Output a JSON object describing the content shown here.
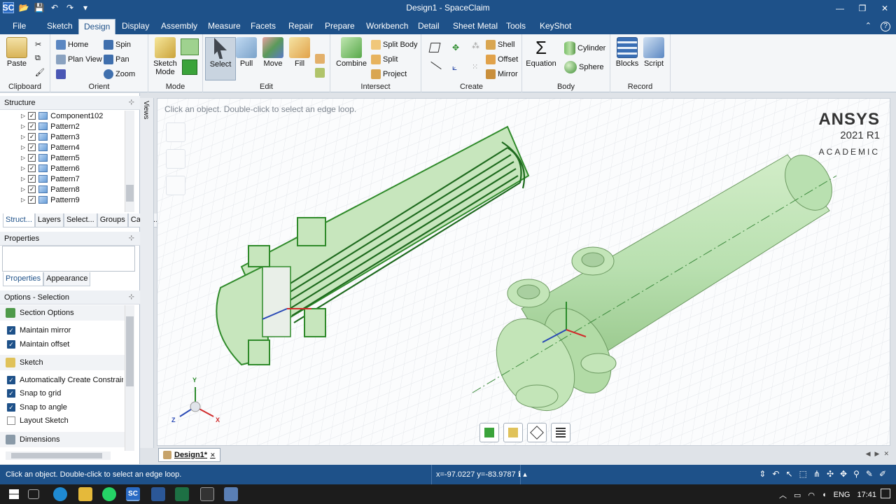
{
  "window": {
    "title": "Design1 - SpaceClaim",
    "app_badge": "SC",
    "minimize": "—",
    "maximize": "❐",
    "close": "✕"
  },
  "qat": {
    "open": "📂",
    "save": "💾",
    "undo": "↶",
    "redo": "↷",
    "more": "▾"
  },
  "menu": {
    "tabs": [
      "File",
      "Sketch",
      "Design",
      "Display",
      "Assembly",
      "Measure",
      "Facets",
      "Repair",
      "Prepare",
      "Workbench",
      "Detail",
      "Sheet Metal",
      "Tools",
      "KeyShot"
    ],
    "active": "Design",
    "collapse": "⌃",
    "help": "?"
  },
  "ribbon": {
    "clipboard": {
      "label": "Clipboard",
      "paste": "Paste"
    },
    "orient": {
      "label": "Orient",
      "home": "Home",
      "plan_view": "Plan View",
      "spin": "Spin",
      "pan": "Pan",
      "zoom": "Zoom"
    },
    "mode": {
      "label": "Mode",
      "sketch_mode": "Sketch Mode"
    },
    "edit": {
      "label": "Edit",
      "select": "Select",
      "pull": "Pull",
      "move": "Move",
      "fill": "Fill"
    },
    "intersect": {
      "label": "Intersect",
      "combine": "Combine",
      "split_body": "Split Body",
      "split": "Split",
      "project": "Project"
    },
    "create": {
      "label": "Create",
      "shell": "Shell",
      "offset": "Offset",
      "mirror": "Mirror"
    },
    "body": {
      "label": "Body",
      "equation": "Equation",
      "cylinder": "Cylinder",
      "sphere": "Sphere"
    },
    "record": {
      "label": "Record",
      "blocks": "Blocks",
      "script": "Script"
    }
  },
  "structure": {
    "title": "Structure",
    "items": [
      "Component102",
      "Pattern2",
      "Pattern3",
      "Pattern4",
      "Pattern5",
      "Pattern6",
      "Pattern7",
      "Pattern8",
      "Pattern9"
    ],
    "tabs": [
      "Struct...",
      "Layers",
      "Select...",
      "Groups",
      "Came..."
    ]
  },
  "properties": {
    "title": "Properties",
    "tabs": [
      "Properties",
      "Appearance"
    ]
  },
  "options": {
    "title": "Options - Selection",
    "section_options": "Section Options",
    "maintain_mirror": "Maintain mirror",
    "maintain_offset": "Maintain offset",
    "sketch": "Sketch",
    "auto_constraints": "Automatically Create Constraints",
    "snap_grid": "Snap to grid",
    "snap_angle": "Snap to angle",
    "layout_sketch": "Layout Sketch",
    "dimensions": "Dimensions"
  },
  "views_label": "Views",
  "viewport": {
    "hint": "Click an object. Double-click to select an edge loop.",
    "brand": "ANSYS",
    "version": "2021 R1",
    "edition": "ACADEMIC",
    "triad": {
      "x": "X",
      "y": "Y",
      "z": "Z"
    }
  },
  "doc": {
    "tab": "Design1*",
    "close": "✕"
  },
  "status": {
    "message": "Click an object. Double-click to select an edge loop.",
    "coords": "x=-97.0227  y=-83.9787",
    "info": "ℹ ▴"
  },
  "taskbar": {
    "lang": "ENG",
    "time": "17:41"
  },
  "colors": {
    "accent": "#1e5189",
    "model_fill": "#b9e0b0",
    "model_section": "#2f8a2a"
  }
}
